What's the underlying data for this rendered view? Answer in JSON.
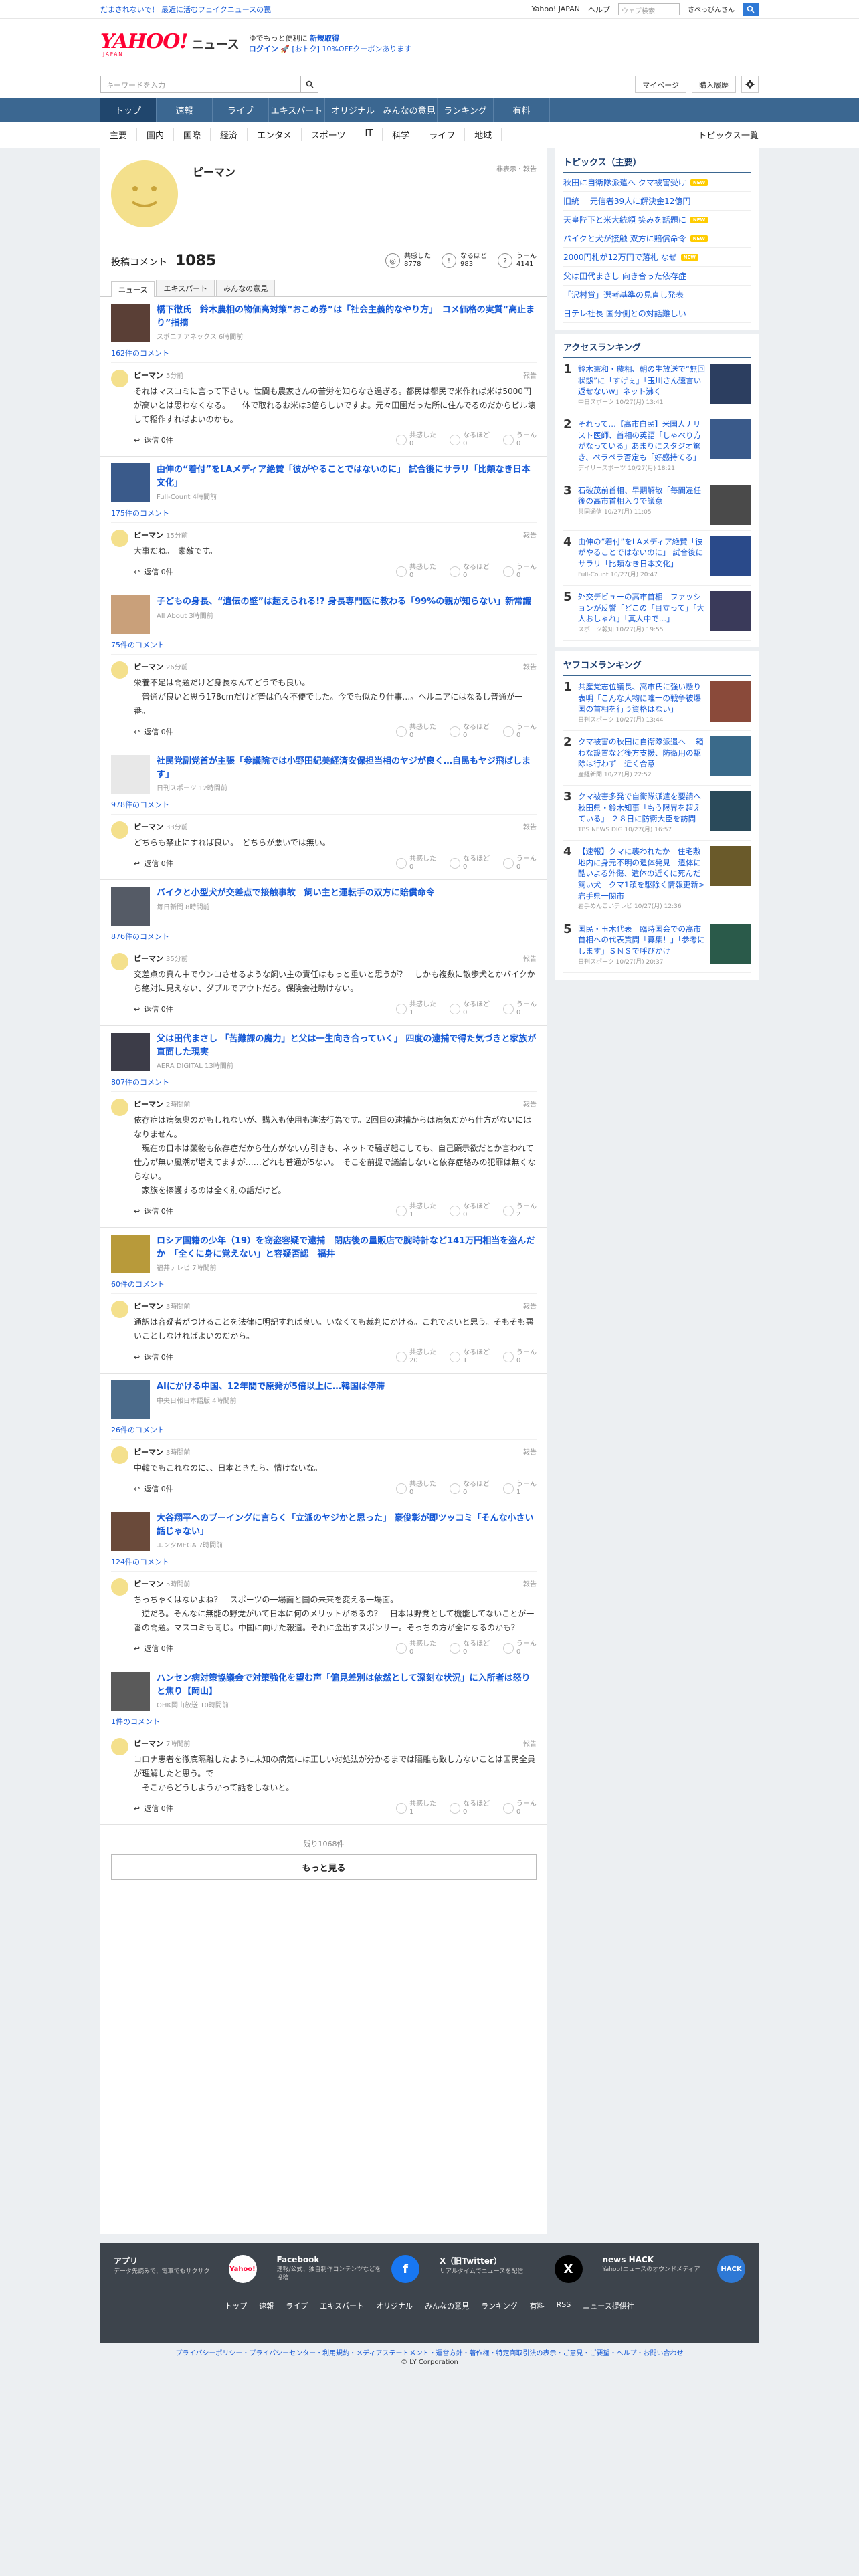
{
  "promo": {
    "left": "だまされないで！ 最近に活むフェイクニュースの罠",
    "yjapan": "Yahoo! JAPAN",
    "help": "ヘルプ",
    "search_placeholder": "ウェブ検索",
    "user": "さべっぴんさん"
  },
  "header": {
    "logo": "YAHOO!",
    "logo_sub": "JAPAN",
    "news": "ニュース",
    "line1_a": "ゆでもっと便利に",
    "line1_b": "新規取得",
    "login": "ログイン",
    "coupon": "[おトク] 10%OFFクーポンあります"
  },
  "search": {
    "placeholder": "キーワードを入力",
    "mypage": "マイページ",
    "history": "購入履歴"
  },
  "gnav": [
    "トップ",
    "速報",
    "ライブ",
    "エキスパート",
    "オリジナル",
    "みんなの意見",
    "ランキング",
    "有料"
  ],
  "subnav": {
    "items": [
      "主要",
      "国内",
      "国際",
      "経済",
      "エンタメ",
      "スポーツ",
      "IT",
      "科学",
      "ライフ",
      "地域"
    ],
    "topics": "トピックス一覧"
  },
  "profile": {
    "name": "ピーマン",
    "report": "非表示・報告",
    "comment_label": "投稿コメント",
    "comment_count": "1085",
    "reacts": [
      {
        "label": "共感した",
        "count": "8778",
        "icon": "sym"
      },
      {
        "label": "なるほど",
        "count": "983",
        "icon": "!"
      },
      {
        "label": "うーん",
        "count": "4141",
        "icon": "?"
      }
    ],
    "tabs": [
      "ニュース",
      "エキスパート",
      "みんなの意見"
    ]
  },
  "comments": [
    {
      "title": "橋下徹氏　鈴木農相の物価高対策“おこめ券”は「社会主義的なやり方」　コメ価格の実質“高止まり”指摘",
      "source": "スポニチアネックス 6時間前",
      "count": "162件のコメント",
      "name": "ピーマン",
      "time": "5分前",
      "text": "それはマスコミに言って下さい。世間も農家さんの苦労を知らなさ過ぎる。都民は都民で米作れば米は5000円が高いとは思わなくなる。　一体で取れるお米は3倍らしいですよ。元々田園だった所に住んでるのだからビル壊して稲作すればよいのかも。",
      "r1": "0",
      "r2": "0",
      "r3": "0",
      "thumb": "#5a3f36"
    },
    {
      "title": "由伸の“着付”をLAメディア絶賛「彼がやることではないのに」 試合後にサラリ「比類なき日本文化」",
      "source": "Full-Count 4時間前",
      "count": "175件のコメント",
      "name": "ピーマン",
      "time": "15分前",
      "text": "大事だね。　素敵です。",
      "r1": "0",
      "r2": "0",
      "r3": "0",
      "thumb": "#3a5a8a"
    },
    {
      "title": "子どもの身長、“遺伝の壁”は超えられる!? 身長専門医に教わる「99%の親が知らない」新常識",
      "source": "All About 3時間前",
      "count": "75件のコメント",
      "name": "ピーマン",
      "time": "26分前",
      "text": "栄養不足は問題だけど身長なんてどうでも良い。\n　普通が良いと思う178cmだけど普は色々不便でした。今でも似たり仕事…。ヘルニアにはなるし普通が一番。",
      "r1": "0",
      "r2": "0",
      "r3": "0",
      "thumb": "#c9a07a"
    },
    {
      "title": "社民党副党首が主張「参議院では小野田紀美経済安保担当相のヤジが良く…自民もヤジ飛ばします」",
      "source": "日刊スポーツ 12時間前",
      "count": "978件のコメント",
      "name": "ピーマン",
      "time": "33分前",
      "text": "どちらも禁止にすれば良い。　どちらが悪いでは無い。",
      "r1": "0",
      "r2": "0",
      "r3": "0",
      "thumb": "#e8e8e8"
    },
    {
      "title": "バイクと小型犬が交差点で接触事故　飼い主と運転手の双方に賠償命令",
      "source": "毎日新聞 8時間前",
      "count": "876件のコメント",
      "name": "ピーマン",
      "time": "35分前",
      "text": "交差点の真ん中でウンコさせるような飼い主の責任はもっと重いと思うが？　しかも複数に散歩犬とかバイクから絶対に見えない、ダブルでアウトだろ。保険会社助けない。",
      "r1": "1",
      "r2": "0",
      "r3": "0",
      "thumb": "#555b66"
    },
    {
      "title": "父は田代まさし 「苦難課の魔力」と父は一生向き合っていく」 四度の逮捕で得た気づきと家族が直面した現実",
      "source": "AERA DIGITAL 13時間前",
      "count": "807件のコメント",
      "name": "ピーマン",
      "time": "2時間前",
      "text": "依存症は病気奥のかもしれないが、購入も使用も違法行為です。2回目の逮捕からは病気だから仕方がないにはなりません。\n　現在の日本は薬物も依存症だから仕方がない方引きも、ネットで騒ぎ起こしても、自己顕示欲だとか言われて仕方が無い風潮が増えてますが……どれも普通が5ない。　そこを前提で議論しないと依存症絡みの犯罪は無くならない。\n　家族を擦護するのは全く別の話だけど。",
      "r1": "1",
      "r2": "0",
      "r3": "2",
      "thumb": "#3c3c48"
    },
    {
      "title": "ロシア国籍の少年（19）を窃盗容疑で逮捕　閉店後の量販店で腕時計など141万円相当を盗んだか　「全くに身に覚えない」と容疑否認　福井",
      "source": "福井テレビ 7時間前",
      "count": "60件のコメント",
      "name": "ピーマン",
      "time": "3時間前",
      "text": "通訳は容疑者がつけることを法律に明記すれば良い。いなくても裁判にかける。これでよいと思う。そもそも悪いことしなければよいのだから。",
      "r1": "20",
      "r2": "1",
      "r3": "0",
      "thumb": "#b89a3a"
    },
    {
      "title": "AIにかける中国、12年間で原発が5倍以上に…韓国は停滞",
      "source": "中央日報日本語版 4時間前",
      "count": "26件のコメント",
      "name": "ピーマン",
      "time": "3時間前",
      "text": "中韓でもこれなのに、、日本ときたら、情けないな。",
      "r1": "0",
      "r2": "0",
      "r3": "1",
      "thumb": "#4a6a8a"
    },
    {
      "title": "大谷翔平へのブーイングに言らく「立派のヤジかと思った」 豪俊彰が即ツッコミ「そんな小さい話じゃない」",
      "source": "エンタMEGA 7時間前",
      "count": "124件のコメント",
      "name": "ピーマン",
      "time": "5時間前",
      "text": "ちっちゃくはないよね？　スポーツの一場面と国の未来を変える一場面。\n　逆だろ。そんなに無能の野党がいて日本に何のメリットがあるの？　日本は野党として機能してないことが一番の問題。マスコミも同じ。中国に向けた報道。それに金出すスポンサー。そっちの方が全になるのかも？",
      "r1": "0",
      "r2": "0",
      "r3": "0",
      "thumb": "#6a4a3a"
    },
    {
      "title": "ハンセン病対策協議会で対策強化を望む声「偏見差別は依然として深刻な状況」に入所者は怒りと焦り【岡山】",
      "source": "OHK岡山放送 10時間前",
      "count": "1件のコメント",
      "name": "ピーマン",
      "time": "7時間前",
      "text": "コロナ患者を徹底隔離したように未知の病気には正しい対処法が分かるまでは隔離も致し方ないことは国民全員が理解したと思う。で\n　そこからどうしようかって話をしないと。",
      "r1": "1",
      "r2": "0",
      "r3": "0",
      "thumb": "#5a5a5a"
    }
  ],
  "more": {
    "remain": "残り1068件",
    "button": "もっと見る"
  },
  "sidebar": {
    "topics_title": "トピックス（主要）",
    "topics": [
      {
        "t": "秋田に自衛隊派遣へ クマ被害受け",
        "n": "NEW"
      },
      {
        "t": "旧統一 元信者39人に解決金12億円",
        "n": ""
      },
      {
        "t": "天皇陛下と米大統領 笑みを話題に",
        "n": "NEW"
      },
      {
        "t": "パイクと犬が接触 双方に賠償命令",
        "n": "NEW"
      },
      {
        "t": "2000円札が12万円で落札 なぜ",
        "n": "NEW"
      },
      {
        "t": "父は田代まさし 向き合った依存症",
        "n": ""
      },
      {
        "t": "「沢村賞」選考基準の見直し発表",
        "n": ""
      },
      {
        "t": "日テレ社長 国分側との対話難しい",
        "n": ""
      }
    ],
    "access_title": "アクセスランキング",
    "access": [
      {
        "t": "鈴木憲和・農相、朝の生放送で“無回状態”に「すげぇ」「玉川さん速言い返せないw」ネット沸く",
        "m": "中日スポーツ 10/27(月) 13:41",
        "c": "#2c3e60"
      },
      {
        "t": "それって…【高市自民】米国人ナリスト医師、首相の英語「しゃべり方がなっている」あまりにスタジオ驚き、ペラペラ否定も「好感持てる」",
        "m": "デイリースポーツ 10/27(月) 18:21",
        "c": "#3a5a8a"
      },
      {
        "t": "石破茂前首相、早期解散「毎間違任後の高市首相入りで議意",
        "m": "共同通信 10/27(月) 11:05",
        "c": "#4a4a4a"
      },
      {
        "t": "由伸の“着付”をLAメディア絶賛「彼がやることではないのに」 試合後にサラリ「比類なき日本文化」",
        "m": "Full-Count 10/27(月) 20:47",
        "c": "#2a4a8a"
      },
      {
        "t": "外交デビューの高市首相　ファッションが反響「どこの「目立って」「大人おしゃれ」「真人中で…」",
        "m": "スポーツ報知 10/27(月) 19:55",
        "c": "#3a3a5a"
      }
    ],
    "yako_title": "ヤフコメランキング",
    "yako": [
      {
        "t": "共産党志位議長、高市氏に強い懸り表明「こんな人物に唯一の戦争被爆国の首相を行う資格はない」",
        "m": "日刊スポーツ 10/27(月) 13:44",
        "c": "#8a4a3a"
      },
      {
        "t": "クマ被害の秋田に自衛隊派遣へ　 箱わな設置など後方支援、防衛用の駆除は行わず　近く合意",
        "m": "産経新聞 10/27(月) 22:52",
        "c": "#3a6a8a"
      },
      {
        "t": "クマ被害多発で自衛隊派遣を要請へ　秋田県・鈴木知事「もう限界を超えている」 ２８日に防衛大臣を訪問",
        "m": "TBS NEWS DIG 10/27(月) 16:57",
        "c": "#2a4a5a"
      },
      {
        "t": "【速報】クマに襲われたか　住宅敷地内に身元不明の遺体発見　遺体に酷いよる外傷、遺体の近くに死んだ飼い犬　クマ1頭を駆除く情報更新>　岩手県一関市",
        "m": "岩手めんこいテレビ 10/27(月) 12:36",
        "c": "#6a5a2a"
      },
      {
        "t": "国民・玉木代表　臨時国会での高市首相への代表質問「募集！」「参考にします」ＳＮＳで呼びかけ",
        "m": "日刊スポーツ 10/27(月) 20:37",
        "c": "#2a5a4a"
      }
    ]
  },
  "footer": {
    "apps": [
      {
        "name": "アプリ",
        "desc": "データ先読みで、電車でもサクサク",
        "icon": "news-app-icon",
        "label": "Yahoo!",
        "color": "#ffffff"
      },
      {
        "name": "Facebook",
        "desc": "速報/公式、独自制作コンテンツなどを投稿",
        "icon": "facebook-icon",
        "label": "f",
        "color": "#1877f2"
      },
      {
        "name": "X（旧Twitter）",
        "desc": "リアルタイムでニュースを配信",
        "icon": "x-icon",
        "label": "X",
        "color": "#000000"
      },
      {
        "name": "news HACK",
        "desc": "Yahoo!ニュースのオウンドメディア",
        "icon": "newshack-icon",
        "label": "HACK",
        "color": "#2e79d6"
      }
    ],
    "nav": [
      "トップ",
      "速報",
      "ライブ",
      "エキスパート",
      "オリジナル",
      "みんなの意見",
      "ランキング",
      "有料",
      "RSS",
      "ニュース提供社"
    ],
    "legal": "プライバシーポリシー・プライバシーセンター・利用規約・メディアステートメント・運営方針・著作権・特定商取引法の表示・ご意見・ご要望・ヘルプ・お問い合わせ",
    "copyright": "© LY Corporation"
  },
  "colors": {
    "accent": "#3b6791",
    "link": "#1558d6",
    "brand": "#ff0033",
    "new_badge": "#ffcc00"
  }
}
